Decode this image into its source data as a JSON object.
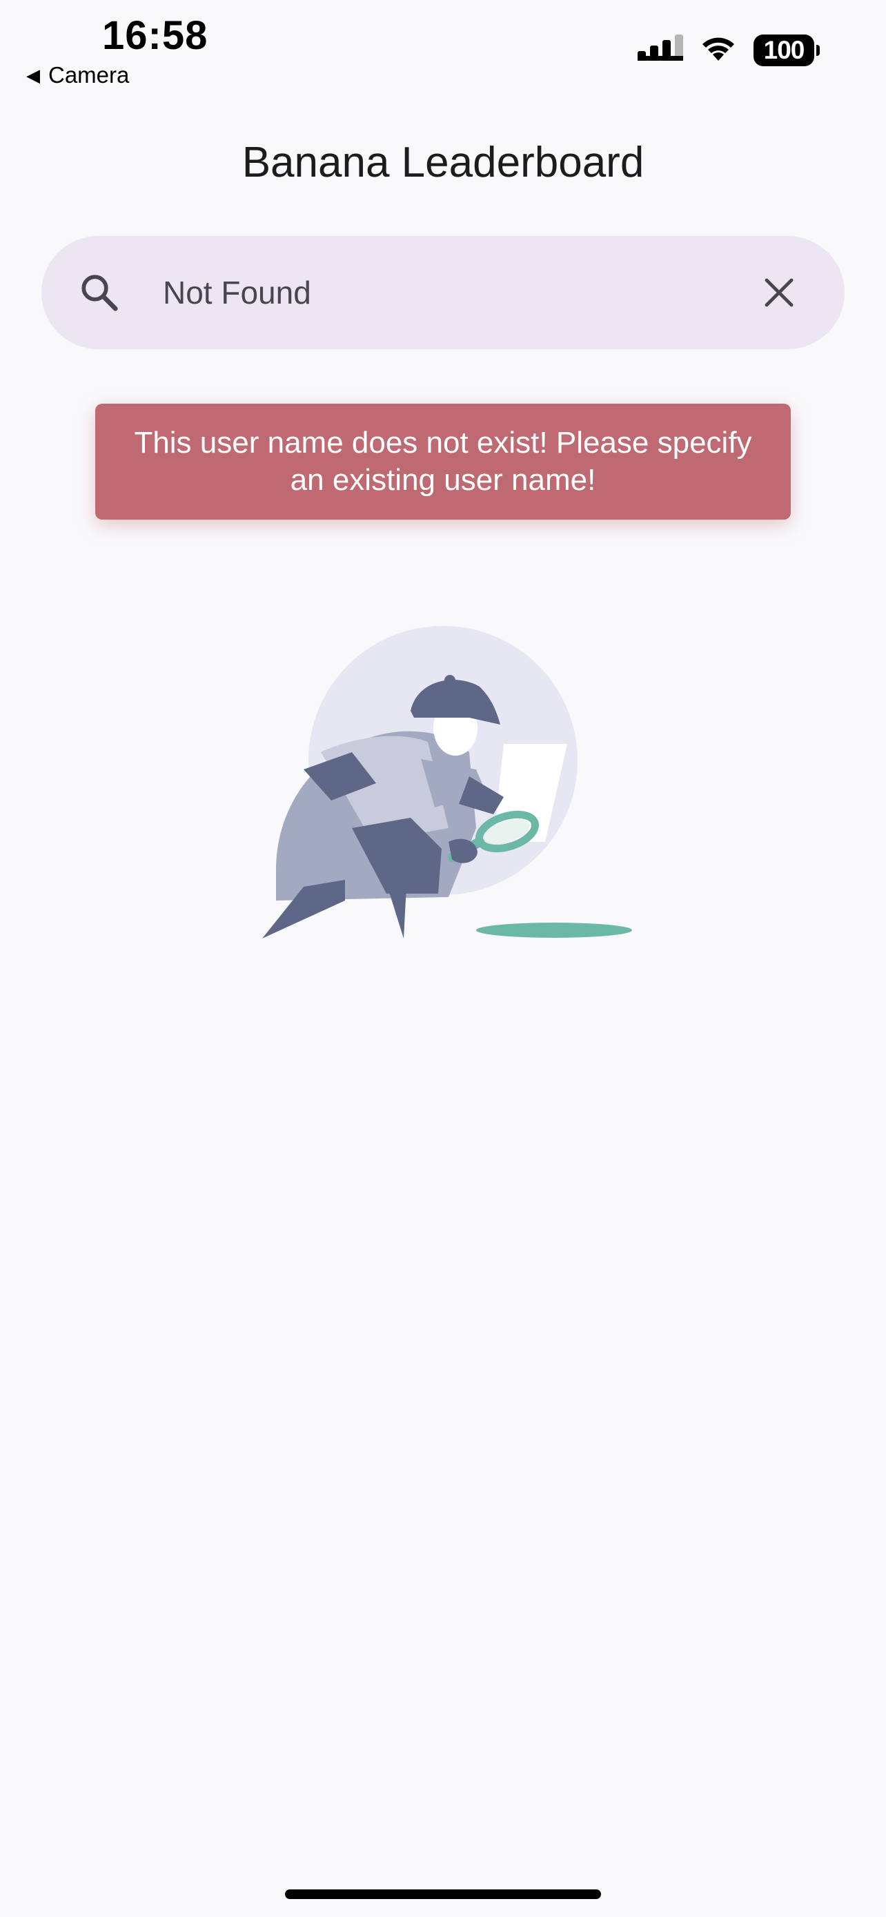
{
  "status_bar": {
    "time": "16:58",
    "back_app": "Camera",
    "battery": "100"
  },
  "header": {
    "title": "Banana Leaderboard"
  },
  "search": {
    "value": "Not Found",
    "placeholder": ""
  },
  "error": {
    "message": "This user name does not exist! Please specify an existing user name!"
  },
  "icons": {
    "search": "search-icon",
    "clear": "close-icon",
    "back": "back-triangle-icon",
    "signal": "cellular-signal-icon",
    "wifi": "wifi-icon",
    "battery": "battery-icon",
    "illustration": "detective-not-found-illustration"
  },
  "colors": {
    "background": "#f9f9fc",
    "search_bg": "#ece6f2",
    "error_bg": "#bf6a72",
    "accent_teal": "#6bb8a6",
    "illustration_dark": "#5f6787"
  }
}
